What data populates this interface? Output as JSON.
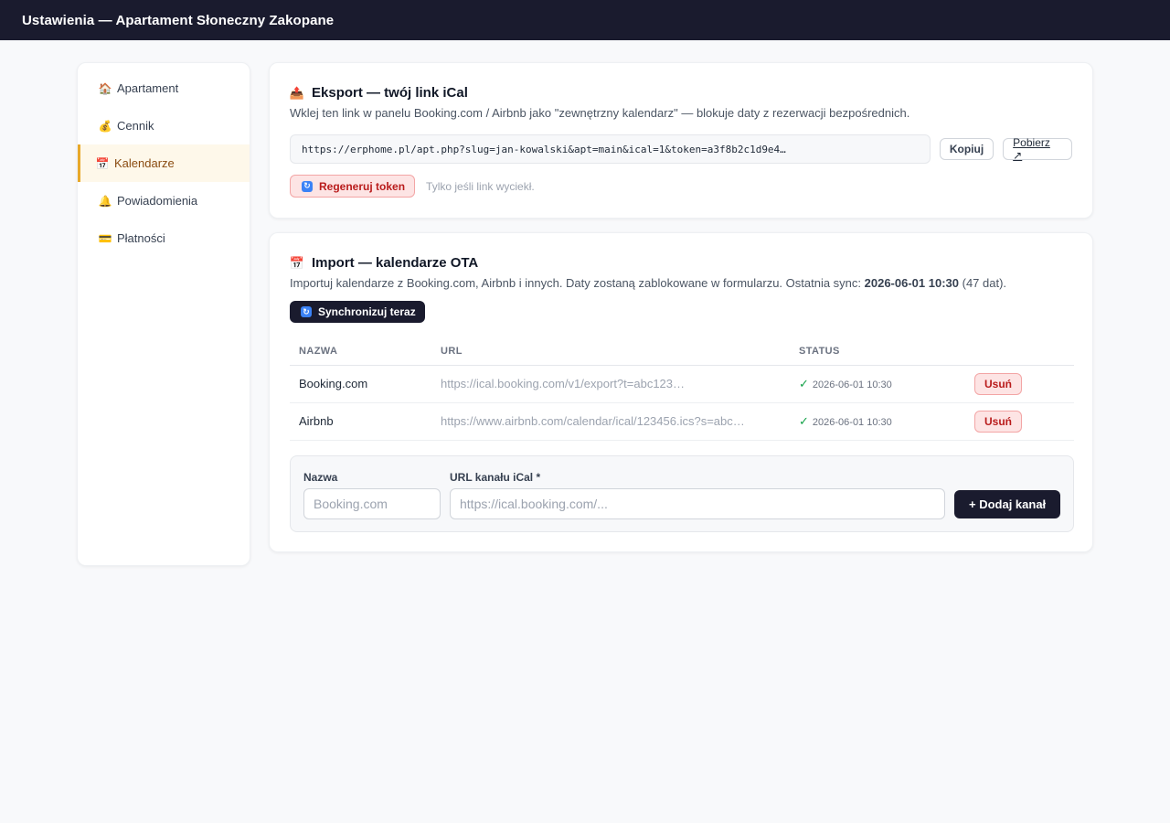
{
  "header": {
    "title": "Ustawienia — Apartament Słoneczny Zakopane"
  },
  "sidebar": {
    "items": [
      {
        "icon": "🏠",
        "label": "Apartament",
        "active": false
      },
      {
        "icon": "💰",
        "label": "Cennik",
        "active": false
      },
      {
        "icon": "📅",
        "label": "Kalendarze",
        "active": true
      },
      {
        "icon": "🔔",
        "label": "Powiadomienia",
        "active": false
      },
      {
        "icon": "💳",
        "label": "Płatności",
        "active": false
      }
    ]
  },
  "export": {
    "icon": "📤",
    "title": "Eksport — twój link iCal",
    "description": "Wklej ten link w panelu Booking.com / Airbnb jako \"zewnętrzny kalendarz\" — blokuje daty z rezerwacji bezpośrednich.",
    "link": "https://erphome.pl/apt.php?slug=jan-kowalski&apt=main&ical=1&token=a3f8b2c1d9e4…",
    "copy_label": "Kopiuj",
    "download_label": "Pobierz ↗",
    "regen_icon": "🔄",
    "regen_label": "Regeneruj token",
    "regen_note": "Tylko jeśli link wyciekł."
  },
  "import": {
    "icon": "📅",
    "title": "Import — kalendarze OTA",
    "description_prefix": "Importuj kalendarze z Booking.com, Airbnb i innych. Daty zostaną zablokowane w formularzu. Ostatnia sync: ",
    "last_sync": "2026-06-01 10:30",
    "description_suffix": " (47 dat).",
    "sync_icon": "🔄",
    "sync_label": "Synchronizuj teraz",
    "columns": [
      "NAZWA",
      "URL",
      "STATUS",
      ""
    ],
    "rows": [
      {
        "name": "Booking.com",
        "url": "https://ical.booking.com/v1/export?t=abc123…",
        "status_icon": "✓",
        "status": "2026-06-01 10:30",
        "delete_label": "Usuń"
      },
      {
        "name": "Airbnb",
        "url": "https://www.airbnb.com/calendar/ical/123456.ics?s=abc…",
        "status_icon": "✓",
        "status": "2026-06-01 10:30",
        "delete_label": "Usuń"
      }
    ],
    "form": {
      "name_label": "Nazwa",
      "name_placeholder": "Booking.com",
      "url_label": "URL kanału iCal *",
      "url_placeholder": "https://ical.booking.com/...",
      "add_label": "+ Dodaj kanał"
    }
  }
}
